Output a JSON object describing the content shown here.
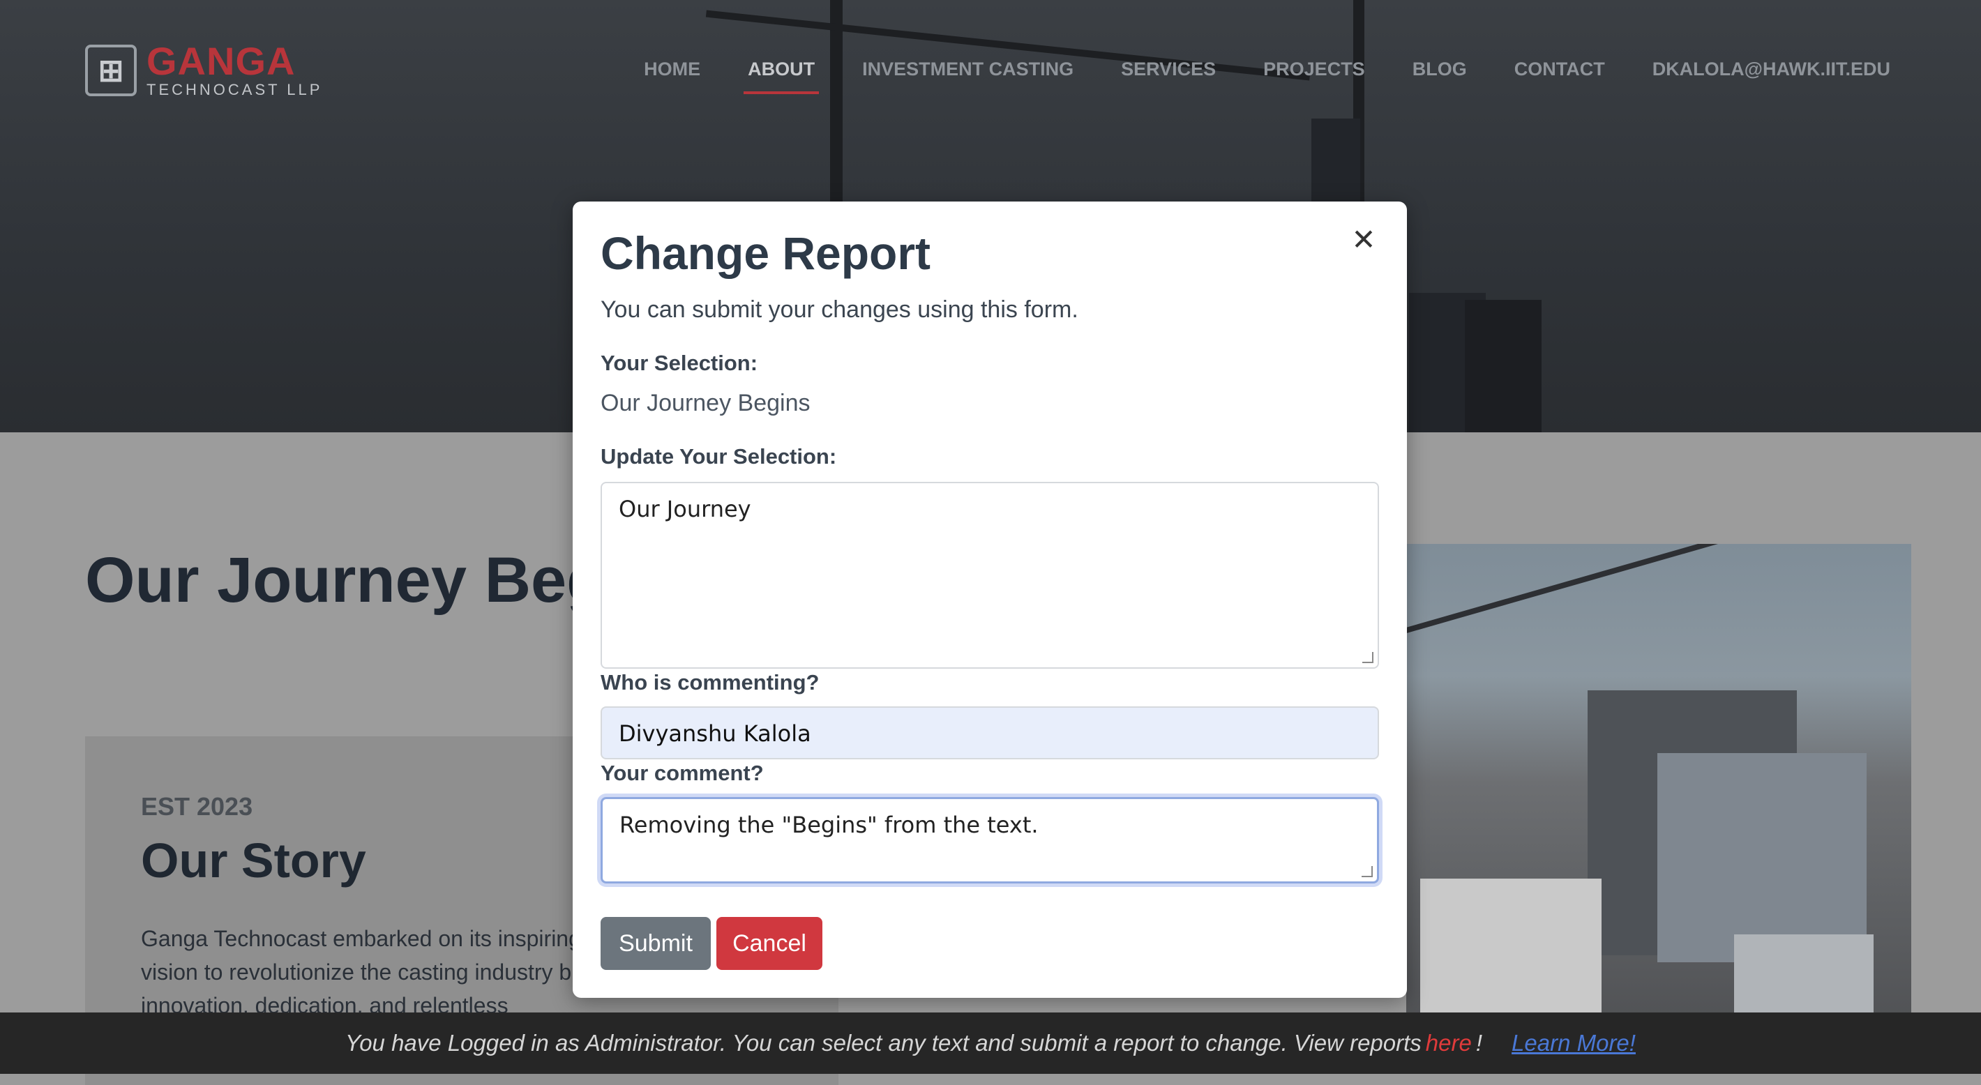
{
  "header": {
    "logo_brand": "GANGA",
    "logo_sub": "TECHNOCAST LLP",
    "nav": [
      {
        "label": "HOME"
      },
      {
        "label": "ABOUT",
        "active": true
      },
      {
        "label": "INVESTMENT CASTING"
      },
      {
        "label": "SERVICES"
      },
      {
        "label": "PROJECTS"
      },
      {
        "label": "BLOG"
      },
      {
        "label": "CONTACT"
      },
      {
        "label": "DKALOLA@HAWK.IIT.EDU"
      }
    ]
  },
  "page": {
    "title": "Our Journey Begins",
    "story": {
      "est": "EST 2023",
      "title": "Our Story",
      "body": "Ganga Technocast embarked on its inspiring journey with a vision to revolutionize the casting industry built on the pillars of innovation, dedication, and relentless"
    }
  },
  "modal": {
    "title": "Change Report",
    "close_icon": "close-icon",
    "description": "You can submit your changes using this form.",
    "selection_label": "Your Selection:",
    "selection_value": "Our Journey Begins",
    "update_label": "Update Your Selection:",
    "update_value": "Our Journey",
    "commenter_label": "Who is commenting?",
    "commenter_value": "Divyanshu Kalola",
    "comment_label": "Your comment?",
    "comment_value": "Removing the \"Begins\" from the text.",
    "submit_label": "Submit",
    "cancel_label": "Cancel"
  },
  "admin_bar": {
    "message": "You have Logged in as Administrator. You can select any text and submit a report to change. View reports",
    "here_label": "here",
    "exclaim": "!",
    "learn_more": "Learn More!"
  },
  "colors": {
    "brand_red": "#b8353b",
    "submit_gray": "#6c757d",
    "cancel_red": "#d0383f",
    "link_blue": "#4a78d6"
  }
}
